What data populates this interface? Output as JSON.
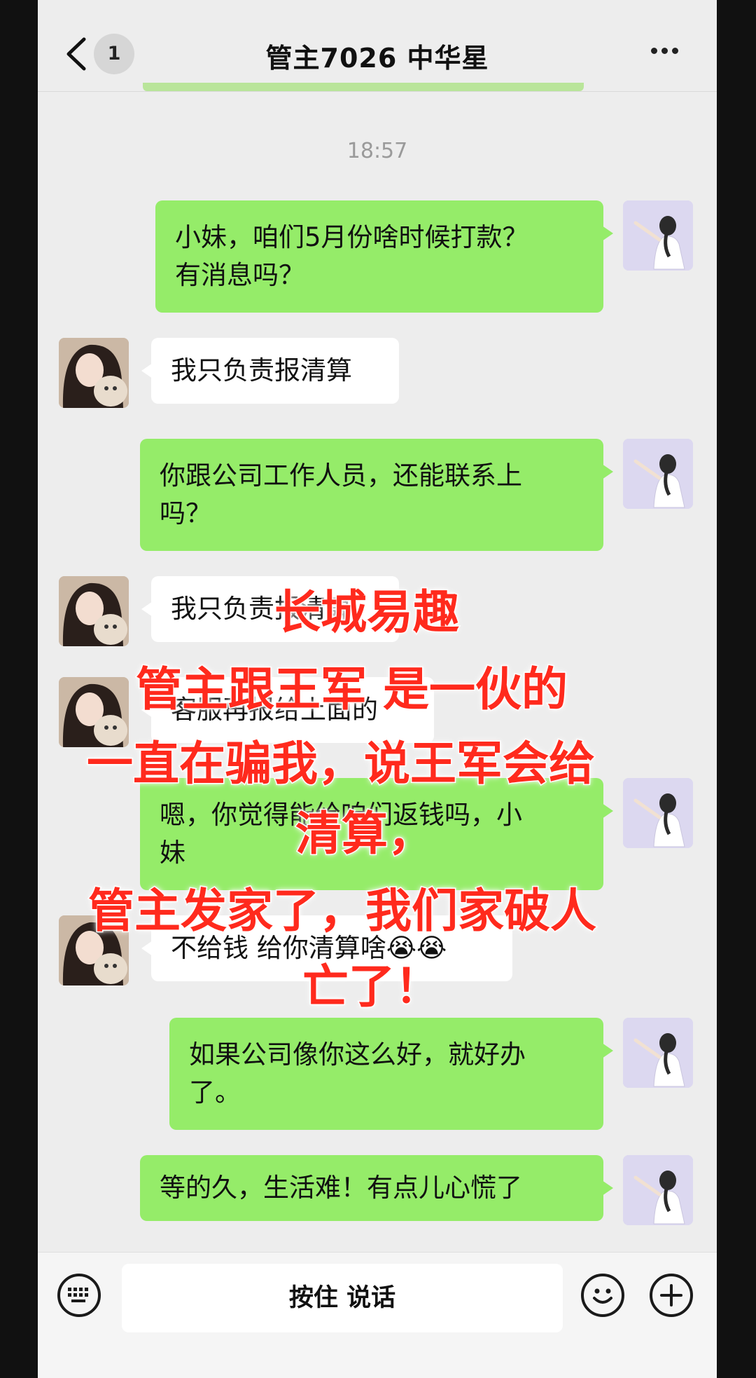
{
  "header": {
    "unread_count": "1",
    "title": "管主7026 中华星"
  },
  "timestamp": "18:57",
  "messages": [
    {
      "from": "me",
      "lines": [
        "小妹，咱们5月份啥时候打款？",
        "有消息吗？"
      ]
    },
    {
      "from": "other",
      "lines": [
        "我只负责报清算"
      ]
    },
    {
      "from": "me",
      "lines": [
        "你跟公司工作人员，还能联系上",
        "吗？"
      ]
    },
    {
      "from": "other",
      "lines": [
        "我只负责报清算"
      ]
    },
    {
      "from": "other",
      "lines": [
        "客服再报给上面的"
      ]
    },
    {
      "from": "me",
      "lines": [
        "嗯，你觉得能给咱们返钱吗，小",
        "妹"
      ]
    },
    {
      "from": "other",
      "lines": [
        "不给钱 给你清算啥😭😭"
      ]
    },
    {
      "from": "me",
      "lines": [
        "如果公司像你这么好，就好办",
        "了。"
      ]
    },
    {
      "from": "me",
      "lines": [
        "等的久，生活难！有点儿心慌了"
      ]
    }
  ],
  "overlay": {
    "lines": [
      "长城易趣",
      "管主跟王军 是一伙的",
      "一直在骗我，说王军会给",
      "清算，",
      "管主发家了，我们家破人",
      "亡了！"
    ],
    "color": "#ff2a1d"
  },
  "input_bar": {
    "hold_to_talk": "按住 说话"
  },
  "colors": {
    "my_bubble": "#95ec69",
    "other_bubble": "#ffffff",
    "background": "#ededed"
  }
}
